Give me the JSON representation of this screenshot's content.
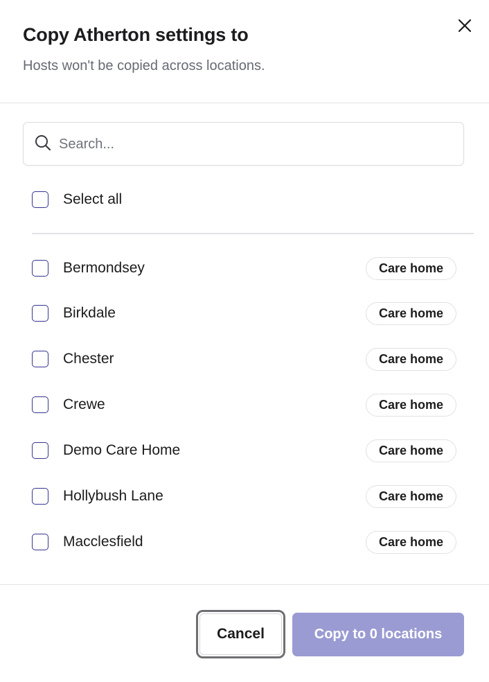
{
  "dialog": {
    "title": "Copy Atherton settings to",
    "subtitle": "Hosts won't be copied across locations.",
    "close_icon": "close-icon"
  },
  "search": {
    "placeholder": "Search...",
    "value": "",
    "icon": "search-icon"
  },
  "select_all": {
    "label": "Select all",
    "checked": false
  },
  "locations": [
    {
      "name": "Bermondsey",
      "type": "Care home",
      "checked": false
    },
    {
      "name": "Birkdale",
      "type": "Care home",
      "checked": false
    },
    {
      "name": "Chester",
      "type": "Care home",
      "checked": false
    },
    {
      "name": "Crewe",
      "type": "Care home",
      "checked": false
    },
    {
      "name": "Demo Care Home",
      "type": "Care home",
      "checked": false
    },
    {
      "name": "Hollybush Lane",
      "type": "Care home",
      "checked": false
    },
    {
      "name": "Macclesfield",
      "type": "Care home",
      "checked": false
    }
  ],
  "footer": {
    "cancel_label": "Cancel",
    "copy_label": "Copy to 0 locations"
  },
  "colors": {
    "checkbox_border": "#34348f",
    "primary_disabled": "#9a9bd2",
    "text_primary": "#1c1c1e",
    "text_secondary": "#666a73",
    "divider": "#e3e3e6"
  }
}
